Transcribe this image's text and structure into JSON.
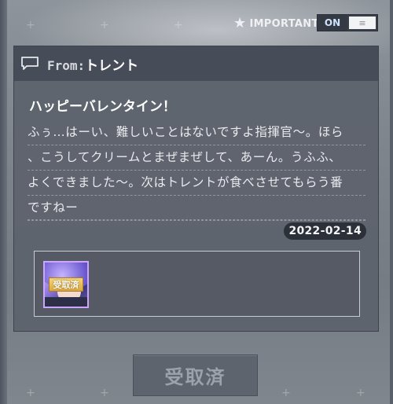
{
  "header": {
    "important_label": "IMPORTANT",
    "toggle_state": "ON",
    "star_icon": "star-icon"
  },
  "mail": {
    "from_prefix": "From:",
    "from_name": "トレント",
    "title": "ハッピーバレンタイン！",
    "body_lines": [
      "ふぅ…はーい、難しいことはないですよ指揮官～。ほら",
      "、こうしてクリームとまぜまぜして、あーん。うふふ、",
      "よくできました～。次はトレントが食べさせてもらう番",
      "ですねー"
    ],
    "date": "2022-02-14"
  },
  "attachment": {
    "items": [
      {
        "status_tag": "受取済",
        "icon": "character-portrait-icon"
      }
    ]
  },
  "actions": {
    "claim_label": "受取済"
  },
  "colors": {
    "panel": "#5c626c",
    "header": "#464c56",
    "date_badge": "#2c3139",
    "claimed_tag": "#e0b24d",
    "button_disabled": "#5d646e"
  }
}
